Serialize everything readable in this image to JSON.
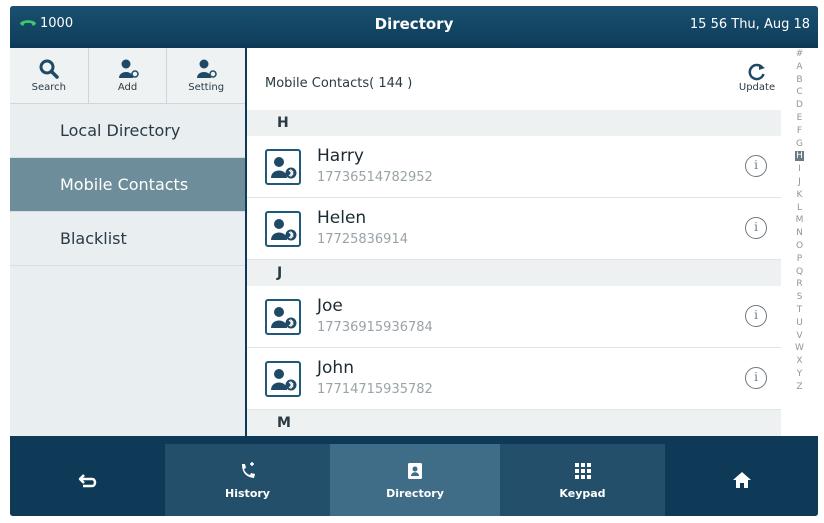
{
  "status": {
    "line": "1000",
    "title": "Directory",
    "datetime": "15 56 Thu, Aug 18"
  },
  "toolbar": {
    "search_label": "Search",
    "add_label": "Add",
    "setting_label": "Setting"
  },
  "nav": {
    "items": [
      {
        "label": "Local Directory"
      },
      {
        "label": "Mobile Contacts"
      },
      {
        "label": "Blacklist"
      }
    ]
  },
  "list": {
    "title": "Mobile Contacts( 144 )",
    "update_label": "Update",
    "groups": [
      {
        "letter": "H",
        "contacts": [
          {
            "name": "Harry",
            "number": "17736514782952"
          },
          {
            "name": "Helen",
            "number": "17725836914"
          }
        ]
      },
      {
        "letter": "J",
        "contacts": [
          {
            "name": "Joe",
            "number": "17736915936784"
          },
          {
            "name": "John",
            "number": "17714715935782"
          }
        ]
      },
      {
        "letter": "M",
        "contacts": []
      }
    ],
    "info_glyph": "i"
  },
  "alphabet": [
    "#",
    "A",
    "B",
    "C",
    "D",
    "E",
    "F",
    "G",
    "H",
    "I",
    "J",
    "K",
    "L",
    "M",
    "N",
    "O",
    "P",
    "Q",
    "R",
    "S",
    "T",
    "U",
    "V",
    "W",
    "X",
    "Y",
    "Z"
  ],
  "alphabet_active": "H",
  "bottombar": {
    "history_label": "History",
    "directory_label": "Directory",
    "keypad_label": "Keypad"
  },
  "colors": {
    "status_bar": "#0f3e5c",
    "accent_active_nav": "#6e8d9a",
    "phone_icon": "#3fc66a"
  }
}
